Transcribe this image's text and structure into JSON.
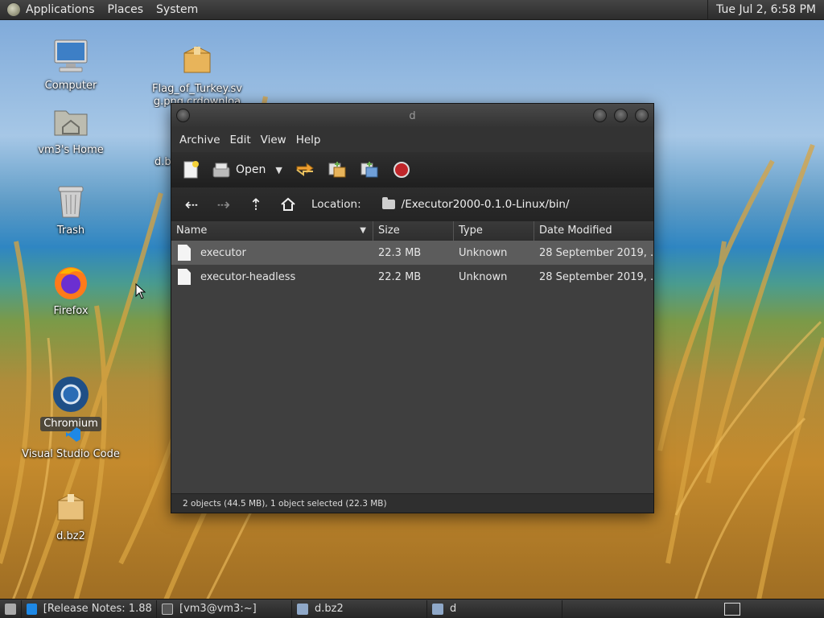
{
  "top_panel": {
    "menus": [
      "Applications",
      "Places",
      "System"
    ],
    "clock": "Tue Jul  2,  6:58 PM"
  },
  "desktop": {
    "icons": [
      {
        "label": "Computer",
        "icon": "computer-icon"
      },
      {
        "label": "Flag_of_Turkey.svg.png.crdownload",
        "icon": "package-icon"
      },
      {
        "label": "vm3's Home",
        "icon": "home-folder-icon"
      },
      {
        "label": "Trash",
        "icon": "trash-icon"
      },
      {
        "label": "Firefox",
        "icon": "firefox-icon"
      },
      {
        "label": "Chromium",
        "icon": "chromium-icon"
      },
      {
        "label": "Visual Studio Code",
        "icon": "vscode-icon"
      },
      {
        "label": "d.bz2",
        "icon": "package-icon"
      }
    ],
    "partial_label": "d.b"
  },
  "window": {
    "title": "d",
    "menus": [
      "Archive",
      "Edit",
      "View",
      "Help"
    ],
    "toolbar": {
      "open_label": "Open"
    },
    "location": {
      "label": "Location:",
      "path": "/Executor2000-0.1.0-Linux/bin/"
    },
    "columns": [
      "Name",
      "Size",
      "Type",
      "Date Modified"
    ],
    "files": [
      {
        "name": "executor",
        "size": "22.3 MB",
        "type": "Unknown",
        "date": "28 September 2019, ..."
      },
      {
        "name": "executor-headless",
        "size": "22.2 MB",
        "type": "Unknown",
        "date": "28 September 2019, ..."
      }
    ],
    "status": "2 objects (44.5 MB), 1 object selected (22.3 MB)"
  },
  "taskbar": {
    "tasks": [
      "[Release Notes: 1.88...",
      "[vm3@vm3:~]",
      "d.bz2",
      "d"
    ]
  }
}
